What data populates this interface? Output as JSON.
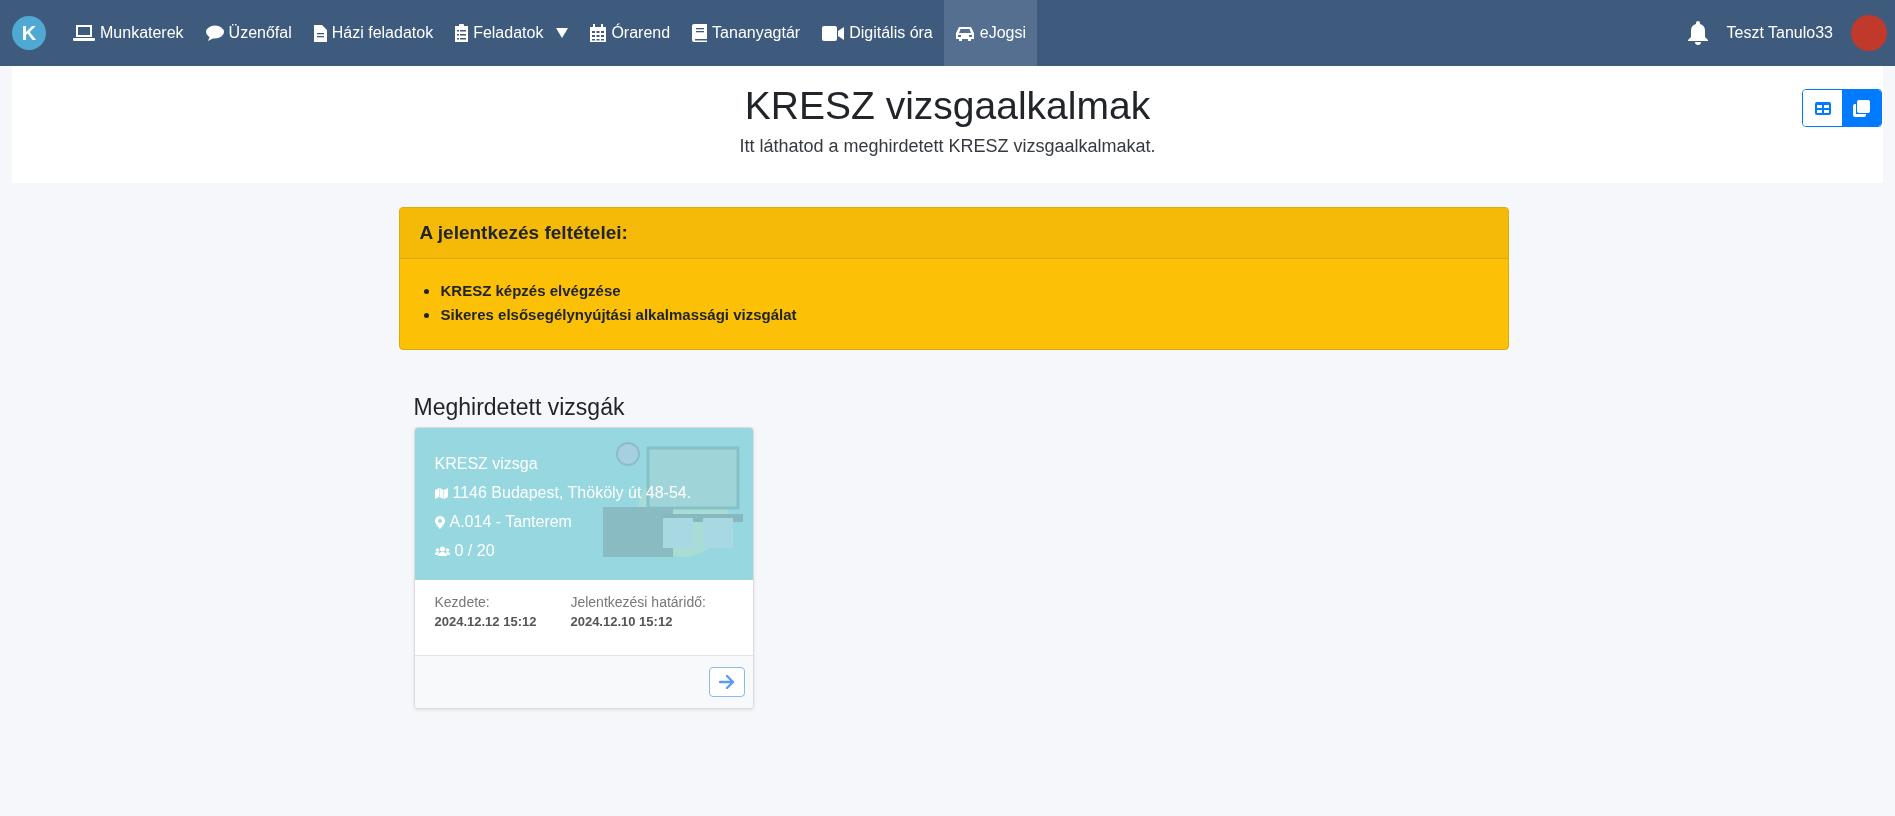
{
  "navbar": {
    "logo": "K",
    "items": [
      {
        "label": "Munkaterek",
        "kind": "laptop",
        "selected": false,
        "dropdown": false
      },
      {
        "label": "Üzenőfal",
        "kind": "comment",
        "selected": false,
        "dropdown": false
      },
      {
        "label": "Házi feladatok",
        "kind": "file",
        "selected": false,
        "dropdown": false
      },
      {
        "label": "Feladatok",
        "kind": "clipboard",
        "selected": false,
        "dropdown": true
      },
      {
        "label": "Órarend",
        "kind": "calendar",
        "selected": false,
        "dropdown": false
      },
      {
        "label": "Tananyagtár",
        "kind": "book",
        "selected": false,
        "dropdown": false
      },
      {
        "label": "Digitális óra",
        "kind": "video",
        "selected": false,
        "dropdown": false
      },
      {
        "label": "eJogsi",
        "kind": "car",
        "selected": true,
        "dropdown": false
      }
    ],
    "user": "Teszt Tanulo33"
  },
  "header": {
    "title": "KRESZ vizsgaalkalmak",
    "subtitle": "Itt láthatod a meghirdetett KRESZ vizsgaalkalmakat.",
    "view_toggle": [
      {
        "kind": "table",
        "selected": false
      },
      {
        "kind": "cards",
        "selected": true
      }
    ]
  },
  "requirements": {
    "title": "A jelentkezés feltételei:",
    "items": [
      "KRESZ képzés elvégzése",
      "Sikeres elsősegélynyújtási alkalmassági vizsgálat"
    ]
  },
  "exams": {
    "title": "Meghirdetett vizsgák",
    "cards": [
      {
        "name": "KRESZ vizsga",
        "address": "1146 Budapest, Thököly út 48-54.",
        "room": "A.014 - Tanterem",
        "seats": "0 / 20",
        "start_label": "Kezdete:",
        "start": "2024.12.12 15:12",
        "deadline_label": "Jelentkezési határidő:",
        "deadline": "2024.12.10 15:12"
      }
    ]
  }
}
